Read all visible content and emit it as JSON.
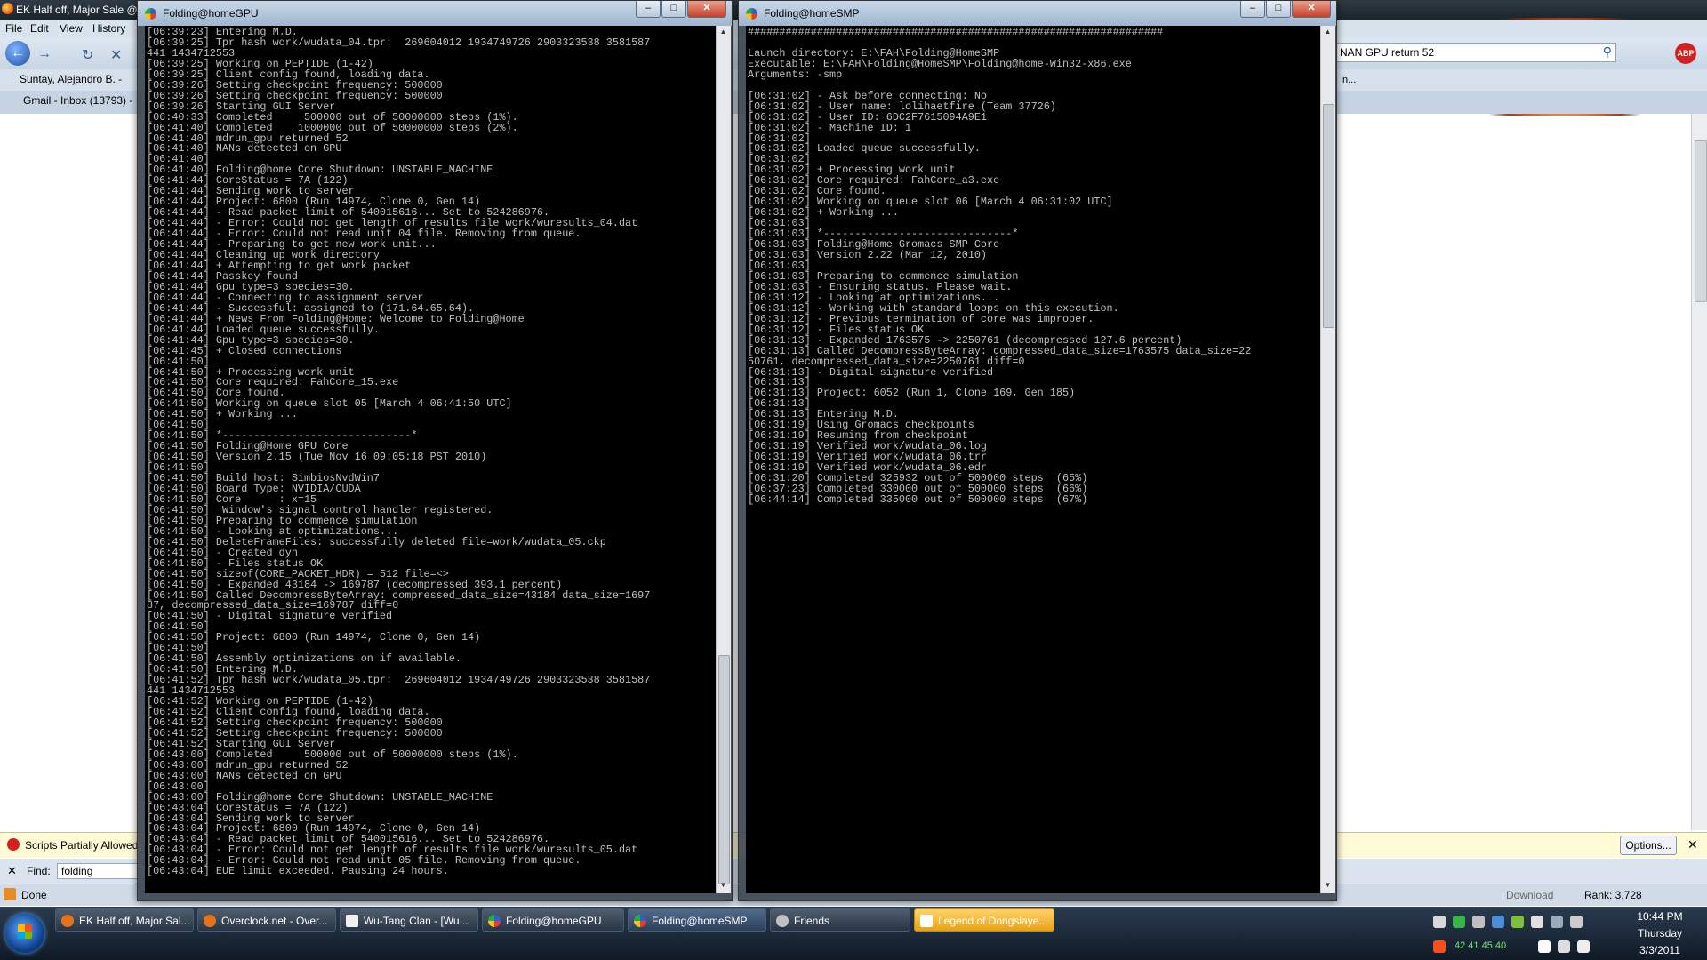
{
  "browser": {
    "title": "EK Half off, Major Sale @",
    "menu": [
      "File",
      "Edit",
      "View",
      "History"
    ],
    "search_value": "NAN GPU return 52",
    "abp_label": "ABP",
    "bookmarks": [
      "Suntay, Alejandro B. -",
      "Gmail - Inbox (13793) -"
    ],
    "right_text": "n...",
    "script_notice": "Scripts Partially Allowed",
    "options_label": "Options...",
    "find_label": "Find:",
    "find_value": "folding",
    "status_text": "Done",
    "download_label": "Download",
    "rank_label": "Rank: 3,728"
  },
  "gpu_window": {
    "title": "Folding@homeGPU",
    "log": "[06:39:23] Entering M.D.\n[06:39:25] Tpr hash work/wudata_04.tpr:  269604012 1934749726 2903323538 3581587\n441 1434712553\n[06:39:25] Working on PEPTIDE (1-42)\n[06:39:25] Client config found, loading data.\n[06:39:26] Setting checkpoint frequency: 500000\n[06:39:26] Setting checkpoint frequency: 500000\n[06:39:26] Starting GUI Server\n[06:40:33] Completed     500000 out of 50000000 steps (1%).\n[06:41:40] Completed    1000000 out of 50000000 steps (2%).\n[06:41:40] mdrun_gpu returned 52\n[06:41:40] NANs detected on GPU\n[06:41:40]\n[06:41:40] Folding@home Core Shutdown: UNSTABLE_MACHINE\n[06:41:44] CoreStatus = 7A (122)\n[06:41:44] Sending work to server\n[06:41:44] Project: 6800 (Run 14974, Clone 0, Gen 14)\n[06:41:44] - Read packet limit of 540015616... Set to 524286976.\n[06:41:44] - Error: Could not get length of results file work/wuresults_04.dat\n[06:41:44] - Error: Could not read unit 04 file. Removing from queue.\n[06:41:44] - Preparing to get new work unit...\n[06:41:44] Cleaning up work directory\n[06:41:44] + Attempting to get work packet\n[06:41:44] Passkey found\n[06:41:44] Gpu type=3 species=30.\n[06:41:44] - Connecting to assignment server\n[06:41:44] - Successful: assigned to (171.64.65.64).\n[06:41:44] + News From Folding@Home: Welcome to Folding@Home\n[06:41:44] Loaded queue successfully.\n[06:41:44] Gpu type=3 species=30.\n[06:41:45] + Closed connections\n[06:41:50]\n[06:41:50] + Processing work unit\n[06:41:50] Core required: FahCore_15.exe\n[06:41:50] Core found.\n[06:41:50] Working on queue slot 05 [March 4 06:41:50 UTC]\n[06:41:50] + Working ...\n[06:41:50]\n[06:41:50] *------------------------------*\n[06:41:50] Folding@Home GPU Core\n[06:41:50] Version 2.15 (Tue Nov 16 09:05:18 PST 2010)\n[06:41:50]\n[06:41:50] Build host: SimbiosNvdWin7\n[06:41:50] Board Type: NVIDIA/CUDA\n[06:41:50] Core      : x=15\n[06:41:50]  Window's signal control handler registered.\n[06:41:50] Preparing to commence simulation\n[06:41:50] - Looking at optimizations...\n[06:41:50] DeleteFrameFiles: successfully deleted file=work/wudata_05.ckp\n[06:41:50] - Created dyn\n[06:41:50] - Files status OK\n[06:41:50] sizeof(CORE_PACKET_HDR) = 512 file=<>\n[06:41:50] - Expanded 43184 -> 169787 (decompressed 393.1 percent)\n[06:41:50] Called DecompressByteArray: compressed_data_size=43184 data_size=1697\n87, decompressed_data_size=169787 diff=0\n[06:41:50] - Digital signature verified\n[06:41:50]\n[06:41:50] Project: 6800 (Run 14974, Clone 0, Gen 14)\n[06:41:50]\n[06:41:50] Assembly optimizations on if available.\n[06:41:50] Entering M.D.\n[06:41:52] Tpr hash work/wudata_05.tpr:  269604012 1934749726 2903323538 3581587\n441 1434712553\n[06:41:52] Working on PEPTIDE (1-42)\n[06:41:52] Client config found, loading data.\n[06:41:52] Setting checkpoint frequency: 500000\n[06:41:52] Setting checkpoint frequency: 500000\n[06:41:52] Starting GUI Server\n[06:43:00] Completed     500000 out of 50000000 steps (1%).\n[06:43:00] mdrun_gpu returned 52\n[06:43:00] NANs detected on GPU\n[06:43:00]\n[06:43:00] Folding@home Core Shutdown: UNSTABLE_MACHINE\n[06:43:04] CoreStatus = 7A (122)\n[06:43:04] Sending work to server\n[06:43:04] Project: 6800 (Run 14974, Clone 0, Gen 14)\n[06:43:04] - Read packet limit of 540015616... Set to 524286976.\n[06:43:04] - Error: Could not get length of results file work/wuresults_05.dat\n[06:43:04] - Error: Could not read unit 05 file. Removing from queue.\n[06:43:04] EUE limit exceeded. Pausing 24 hours."
  },
  "smp_window": {
    "title": "Folding@homeSMP",
    "log": "##################################################################\n\nLaunch directory: E:\\FAH\\Folding@HomeSMP\nExecutable: E:\\FAH\\Folding@HomeSMP\\Folding@home-Win32-x86.exe\nArguments: -smp\n\n[06:31:02] - Ask before connecting: No\n[06:31:02] - User name: lolihaetfire (Team 37726)\n[06:31:02] - User ID: 6DC2F7615094A9E1\n[06:31:02] - Machine ID: 1\n[06:31:02]\n[06:31:02] Loaded queue successfully.\n[06:31:02]\n[06:31:02] + Processing work unit\n[06:31:02] Core required: FahCore_a3.exe\n[06:31:02] Core found.\n[06:31:02] Working on queue slot 06 [March 4 06:31:02 UTC]\n[06:31:02] + Working ...\n[06:31:03]\n[06:31:03] *------------------------------*\n[06:31:03] Folding@Home Gromacs SMP Core\n[06:31:03] Version 2.22 (Mar 12, 2010)\n[06:31:03]\n[06:31:03] Preparing to commence simulation\n[06:31:03] - Ensuring status. Please wait.\n[06:31:12] - Looking at optimizations...\n[06:31:12] - Working with standard loops on this execution.\n[06:31:12] - Previous termination of core was improper.\n[06:31:12] - Files status OK\n[06:31:13] - Expanded 1763575 -> 2250761 (decompressed 127.6 percent)\n[06:31:13] Called DecompressByteArray: compressed_data_size=1763575 data_size=22\n50761, decompressed_data_size=2250761 diff=0\n[06:31:13] - Digital signature verified\n[06:31:13]\n[06:31:13] Project: 6052 (Run 1, Clone 169, Gen 185)\n[06:31:13]\n[06:31:13] Entering M.D.\n[06:31:19] Using Gromacs checkpoints\n[06:31:19] Resuming from checkpoint\n[06:31:19] Verified work/wudata_06.log\n[06:31:19] Verified work/wudata_06.trr\n[06:31:19] Verified work/wudata_06.edr\n[06:31:20] Completed 325932 out of 500000 steps  (65%)\n[06:37:23] Completed 330000 out of 500000 steps  (66%)\n[06:44:14] Completed 335000 out of 500000 steps  (67%)"
  },
  "taskbar": {
    "items": [
      {
        "label": "EK Half off, Major Sal...",
        "icon_color": "#e8721c"
      },
      {
        "label": "Overclock.net - Over...",
        "icon_color": "#e8721c"
      },
      {
        "label": "Wu-Tang Clan - [Wu...",
        "icon_color": "#f0f0f0"
      },
      {
        "label": "Folding@homeGPU",
        "icon_color": "#2b62c9"
      },
      {
        "label": "Folding@homeSMP",
        "icon_color": "#2b62c9"
      },
      {
        "label": "Friends",
        "icon_color": "#c0c0c0"
      },
      {
        "label": "Legend of Dongslaye...",
        "icon_color": "#ffffff"
      }
    ],
    "tray_numbers": "42   41   45   40",
    "clock_time": "10:44 PM",
    "clock_day": "Thursday",
    "clock_date": "3/3/2011"
  }
}
